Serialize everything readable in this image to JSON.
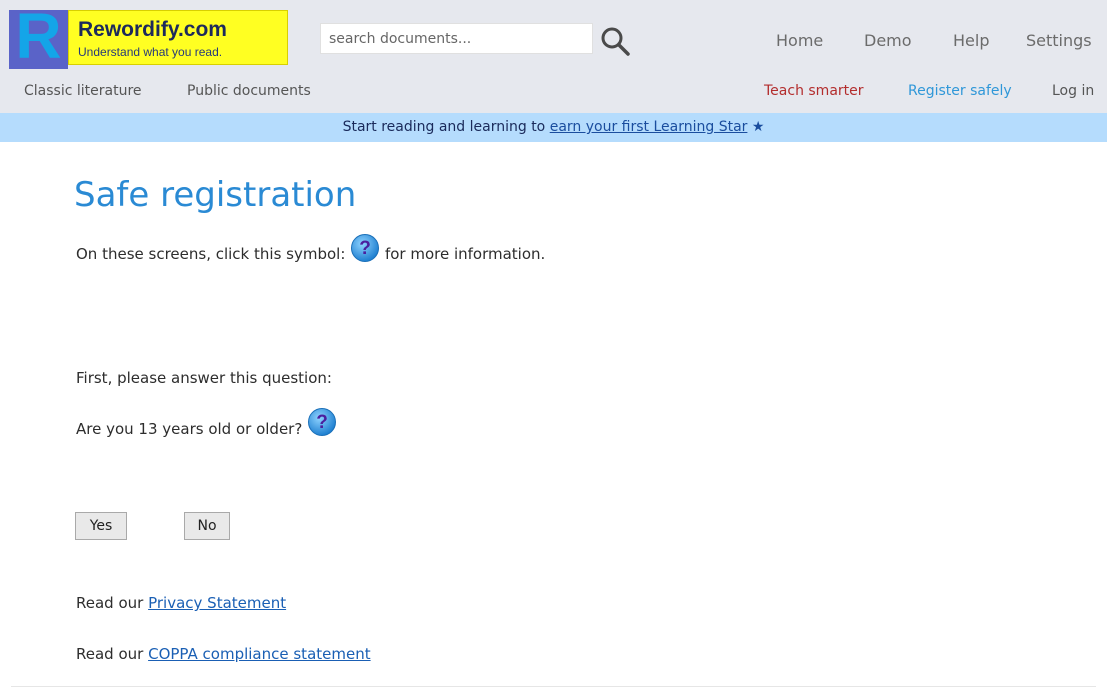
{
  "brand": {
    "logo_letter": "R",
    "name": "Rewordify.com",
    "tagline": "Understand what you read.",
    "colors": {
      "logo_bg": "#5a63c8",
      "logo_letter": "#14a5e8",
      "title_box": "#ffff22"
    }
  },
  "search": {
    "placeholder": "search documents...",
    "icon": "search-icon"
  },
  "top_nav": [
    "Home",
    "Demo",
    "Help",
    "Settings"
  ],
  "sub_nav": {
    "left": [
      "Classic literature",
      "Public documents"
    ],
    "teach": "Teach smarter",
    "register": "Register safely",
    "login": "Log in",
    "colors": {
      "teach": "#b32d2d",
      "register": "#2f97d8"
    }
  },
  "banner": {
    "text": "Start reading and learning to ",
    "link": "earn your first Learning Star",
    "star": "★",
    "bg": "#b5dcfd"
  },
  "main": {
    "title": "Safe registration",
    "info_before": "On these screens, click this symbol:",
    "info_after": "for more information.",
    "question_intro": "First, please answer this question:",
    "question": "Are you 13 years old or older?",
    "help_icon": "question-mark-icon",
    "yes_label": "Yes",
    "no_label": "No",
    "read_our": "Read our",
    "privacy_link": "Privacy Statement",
    "coppa_link": "COPPA compliance statement",
    "title_color": "#2a8ad4"
  }
}
